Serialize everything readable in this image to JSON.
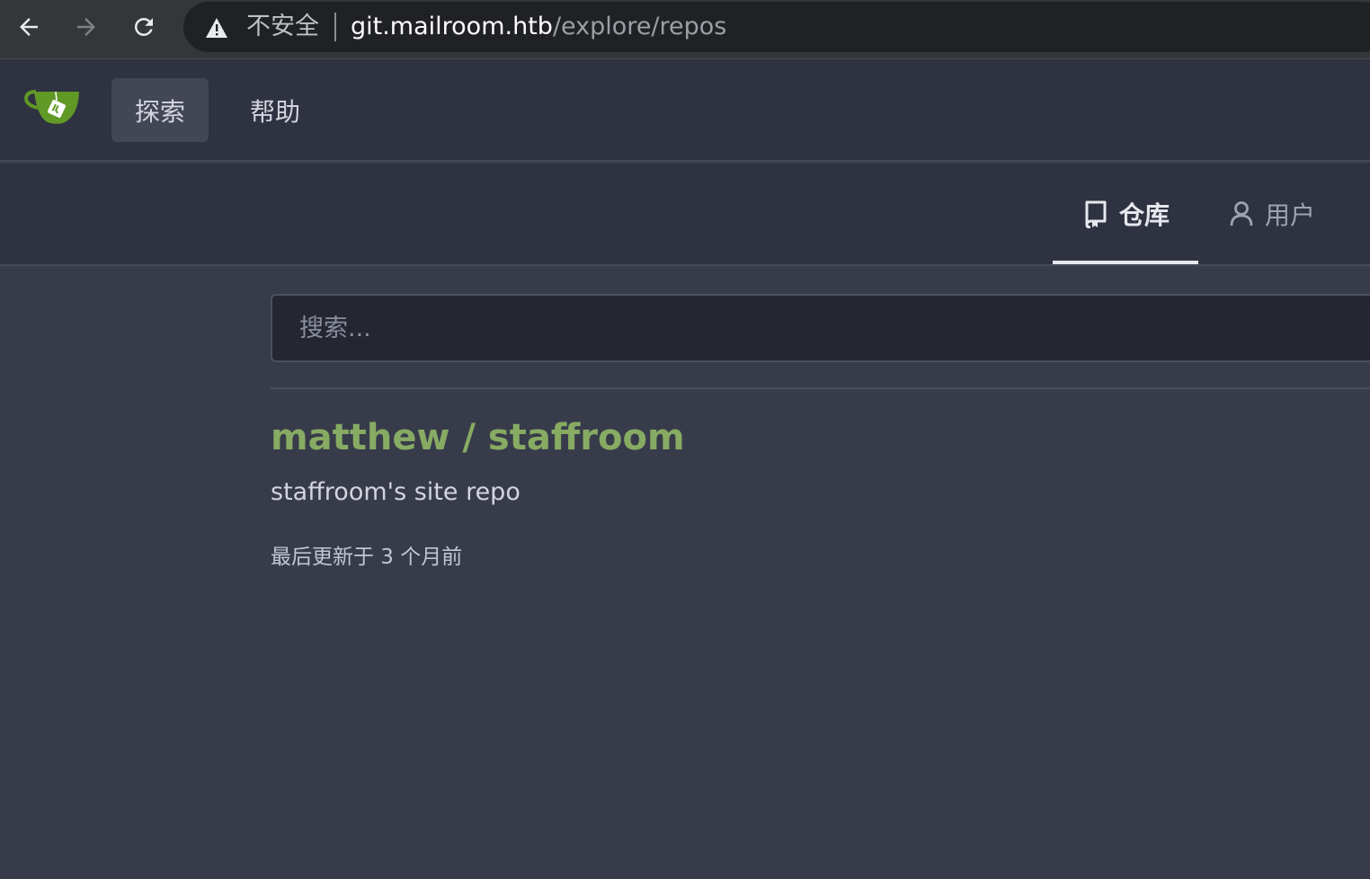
{
  "browser": {
    "back_icon": "arrow-left-icon",
    "forward_icon": "arrow-right-icon",
    "reload_icon": "reload-icon",
    "security_icon": "warning-triangle-icon",
    "security_label": "不安全",
    "url_host": "git.mailroom.htb",
    "url_path": "/explore/repos"
  },
  "header": {
    "logo_icon": "gitea-teacup-logo",
    "nav": [
      {
        "label": "探索",
        "active": true
      },
      {
        "label": "帮助",
        "active": false
      }
    ]
  },
  "tabs": [
    {
      "label": "仓库",
      "icon": "repo-icon",
      "active": true
    },
    {
      "label": "用户",
      "icon": "person-icon",
      "active": false
    }
  ],
  "search": {
    "placeholder": "搜索...",
    "value": ""
  },
  "repos": [
    {
      "name": "matthew / staffroom",
      "description": "staffroom's site repo",
      "updated": "最后更新于 3 个月前"
    }
  ],
  "colors": {
    "page_bg": "#383c4a",
    "header_bg": "#2f3240",
    "accent_green": "#87ab63"
  }
}
